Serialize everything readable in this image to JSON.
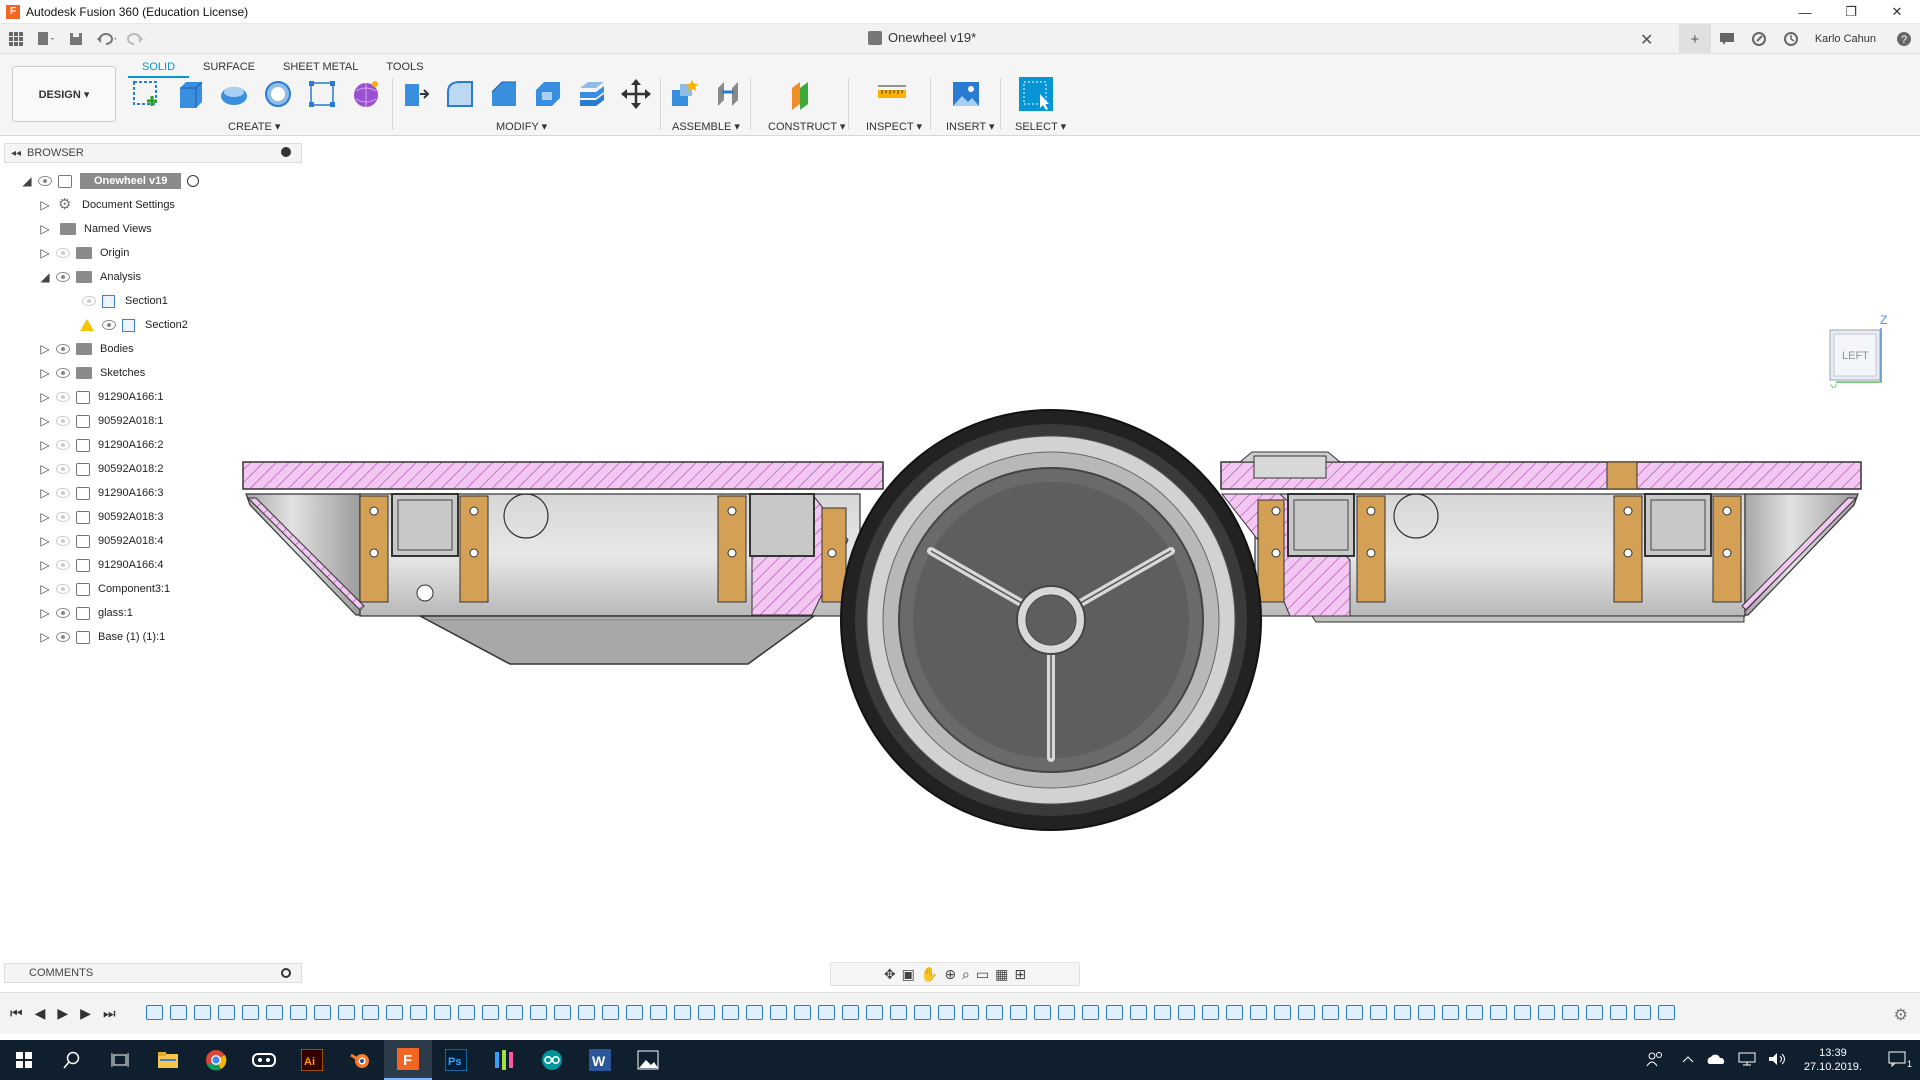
{
  "window": {
    "title": "Autodesk Fusion 360 (Education License)",
    "logo_letter": "F",
    "minimize": "—",
    "restore": "❐",
    "close": "✕"
  },
  "doc_tab": {
    "name": "Onewheel v19*",
    "close": "✕"
  },
  "user": {
    "name": "Karlo Cahun"
  },
  "toolbar": {
    "workspace": "DESIGN ▾",
    "tabs": [
      "SOLID",
      "SURFACE",
      "SHEET METAL",
      "TOOLS"
    ],
    "groups": {
      "create": "CREATE ▾",
      "modify": "MODIFY ▾",
      "assemble": "ASSEMBLE ▾",
      "construct": "CONSTRUCT ▾",
      "inspect": "INSPECT ▾",
      "insert": "INSERT ▾",
      "select": "SELECT ▾"
    }
  },
  "browser": {
    "header": "BROWSER",
    "root": "Onewheel v19",
    "items": [
      "Document Settings",
      "Named Views",
      "Origin",
      "Analysis",
      "Section1",
      "Section2",
      "Bodies",
      "Sketches",
      "91290A166:1",
      "90592A018:1",
      "91290A166:2",
      "90592A018:2",
      "91290A166:3",
      "90592A018:3",
      "90592A018:4",
      "91290A166:4",
      "Component3:1",
      "glass:1",
      "Base (1) (1):1"
    ]
  },
  "viewcube": {
    "face": "LEFT",
    "axis_z": "Z",
    "axis_y": "Y"
  },
  "comments": {
    "header": "COMMENTS"
  },
  "taskbar": {
    "time": "13:39",
    "date": "27.10.2019.",
    "notification_count": "1"
  },
  "colors": {
    "accent": "#0696d7",
    "section_hatch": "#e8b0e8",
    "wood": "#d4a056",
    "taskbar": "#0f1f2e"
  }
}
